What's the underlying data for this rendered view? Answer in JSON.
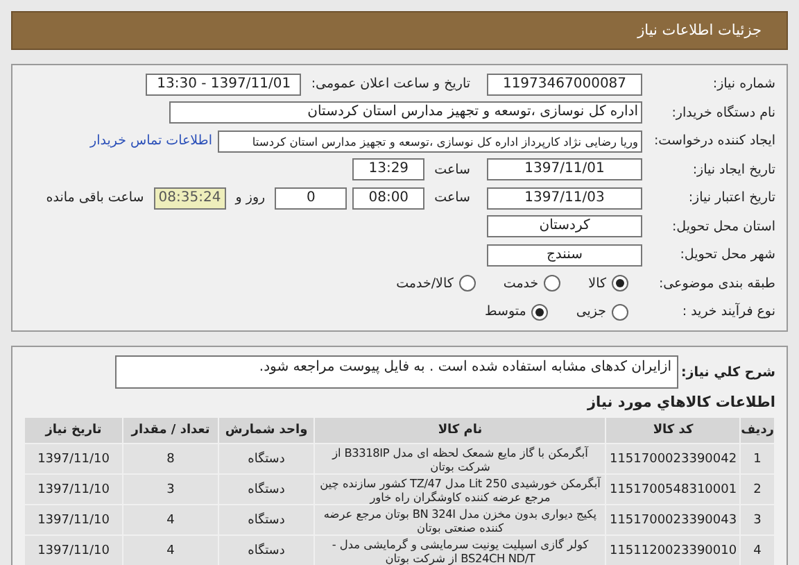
{
  "header": {
    "title": "جزئیات اطلاعات نیاز"
  },
  "form_rows": [
    {
      "label": "شماره نیاز:",
      "items": [
        {
          "kind": "field",
          "value": "11973467000087"
        },
        {
          "kind": "caption",
          "text": "تاریخ و ساعت اعلان عمومی:"
        },
        {
          "kind": "field",
          "value": "1397/11/01 - 13:30"
        }
      ]
    },
    {
      "label": "نام دستگاه خریدار:",
      "items": [
        {
          "kind": "long",
          "value": "اداره کل نوسازی ،توسعه و تجهیز مدارس استان کردستان"
        }
      ]
    },
    {
      "label": "ایجاد کننده درخواست:",
      "items": [
        {
          "kind": "wide",
          "value": "وریا رضایی نژاد کارپرداز اداره کل نوسازی ،توسعه و تجهیز مدارس استان کردستا"
        },
        {
          "kind": "link",
          "text": "اطلاعات تماس خریدار"
        }
      ]
    },
    {
      "label": "تاریخ ایجاد نیاز:",
      "items": [
        {
          "kind": "field",
          "value": "1397/11/01"
        },
        {
          "kind": "caption",
          "text": "ساعت"
        },
        {
          "kind": "short",
          "value": "13:29"
        }
      ]
    },
    {
      "label": "تاریخ اعتبار نیاز:",
      "items": [
        {
          "kind": "field",
          "value": "1397/11/03"
        },
        {
          "kind": "caption",
          "text": "ساعت"
        },
        {
          "kind": "short",
          "value": "08:00"
        },
        {
          "kind": "short",
          "value": "0"
        },
        {
          "kind": "caption",
          "text": "روز و"
        },
        {
          "kind": "highlight",
          "value": "08:35:24"
        },
        {
          "kind": "caption",
          "text": "ساعت باقی مانده"
        }
      ]
    },
    {
      "label": "استان محل تحویل:",
      "items": [
        {
          "kind": "field",
          "value": "کردستان"
        }
      ]
    },
    {
      "label": "شهر محل تحویل:",
      "items": [
        {
          "kind": "field",
          "value": "سنندج"
        }
      ]
    },
    {
      "label": "طبقه بندی موضوعی:",
      "items": [
        {
          "kind": "radio",
          "text": "کالا",
          "selected": true
        },
        {
          "kind": "radio",
          "text": "خدمت",
          "selected": false
        },
        {
          "kind": "radio",
          "text": "کالا/خدمت",
          "selected": false
        }
      ]
    },
    {
      "label": "نوع فرآیند خرید :",
      "items": [
        {
          "kind": "radio",
          "text": "جزیی",
          "selected": false
        },
        {
          "kind": "radio",
          "text": "متوسط",
          "selected": true
        }
      ]
    }
  ],
  "description": {
    "label": "شرح کلي نياز:",
    "value": "ازایران کدهای مشابه استفاده شده است . به فایل پیوست مراجعه شود."
  },
  "goods": {
    "title": "اطلاعات کالاهاي مورد نياز",
    "columns": [
      "رديف",
      "کد کالا",
      "نام کالا",
      "واحد شمارش",
      "تعداد / مقدار",
      "تاریخ نیاز"
    ],
    "rows": [
      [
        "1",
        "1151700023390042",
        "آبگرمکن با گاز مایع شمعک لحظه ای مدل B3318IP از شرکت بوتان",
        "دستگاه",
        "8",
        "1397/11/10"
      ],
      [
        "2",
        "1151700548310001",
        "آبگرمکن خورشیدی 250 Lit مدل TZ/47 کشور سازنده چین مرجع عرضه کننده کاوشگران راه خاور",
        "دستگاه",
        "3",
        "1397/11/10"
      ],
      [
        "3",
        "1151700023390043",
        "پکیج دیواری بدون مخزن مدل BN 324I بوتان مرجع عرضه کننده صنعتی بوتان",
        "دستگاه",
        "4",
        "1397/11/10"
      ],
      [
        "4",
        "1151120023390010",
        "کولر گازی اسپلیت یونیت سرمایشی و گرمایشی مدل -BS24CH ND/T از شرکت بوتان",
        "دستگاه",
        "4",
        "1397/11/10"
      ]
    ]
  }
}
